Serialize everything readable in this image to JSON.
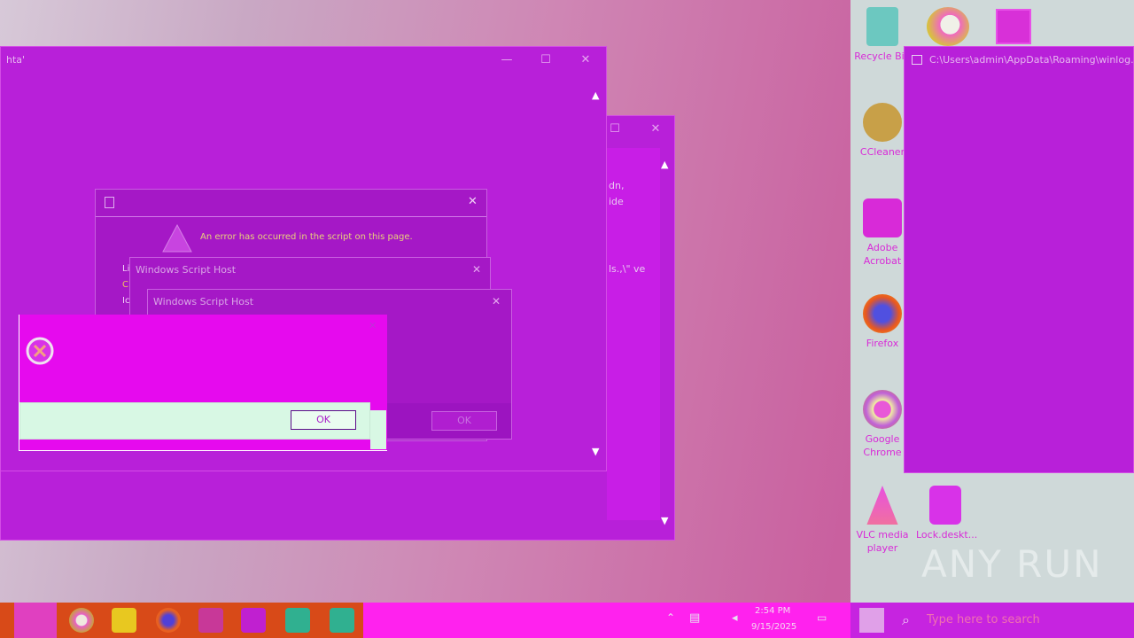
{
  "main_window": {
    "title": "hta'",
    "minimize": "—",
    "maximize": "☐",
    "close": "✕",
    "scroll_up": "▲",
    "scroll_down": "▼"
  },
  "back_window": {
    "maximize": "☐",
    "close": "✕",
    "text_lines": [
      "dn,",
      "ide",
      "ls.,\\\" ve"
    ],
    "scroll_up": "▲",
    "scroll_down": "▼"
  },
  "right_window": {
    "title": "C:\\Users\\admin\\AppData\\Roaming\\winlog..."
  },
  "script_error_dialog": {
    "close": "✕",
    "message": "An error has occurred in the script on this page.",
    "fragments": [
      "Li",
      "C",
      "Ic"
    ]
  },
  "wsh_dialog_1": {
    "title": "Windows Script Host",
    "close": "✕"
  },
  "wsh_dialog_2": {
    "title": "Windows Script Host",
    "close": "✕",
    "ok_label": "OK"
  },
  "error_box": {
    "ok_label": "OK",
    "close": "✕"
  },
  "desktop_icons": [
    {
      "label": "Recycle Bin",
      "icon": "recycle-bin-icon"
    },
    {
      "label": "CCleaner",
      "icon": "ccleaner-icon"
    },
    {
      "label": "Adobe Acrobat",
      "icon": "acrobat-icon"
    },
    {
      "label": "Firefox",
      "icon": "firefox-icon"
    },
    {
      "label": "Google Chrome",
      "icon": "chrome-icon"
    },
    {
      "label": "VLC media player",
      "icon": "vlc-icon"
    },
    {
      "label": "Lock.deskt...",
      "icon": "file-icon"
    }
  ],
  "taskbar": {
    "search_placeholder": "Type here to search",
    "time": "2:54 PM",
    "date": "9/15/2025"
  },
  "watermark": "ANY RUN"
}
